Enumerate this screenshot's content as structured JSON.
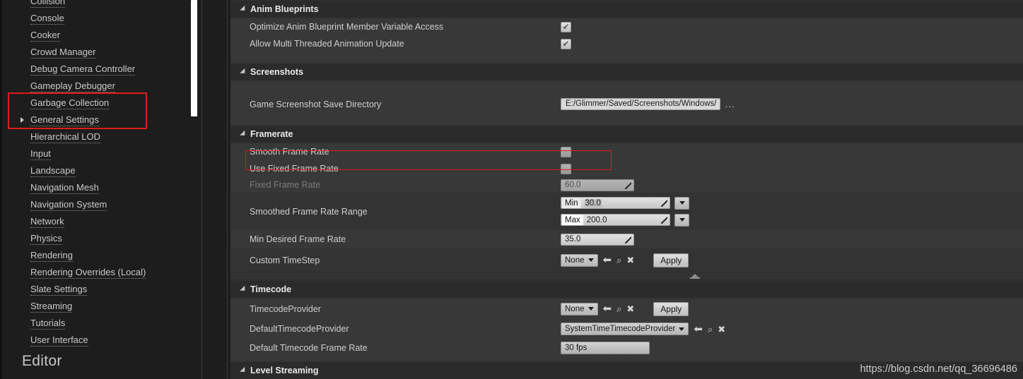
{
  "sidebar": {
    "items": [
      {
        "label": "Collision",
        "expandable": false,
        "clipped": true
      },
      {
        "label": "Console",
        "expandable": false
      },
      {
        "label": "Cooker",
        "expandable": false
      },
      {
        "label": "Crowd Manager",
        "expandable": false
      },
      {
        "label": "Debug Camera Controller",
        "expandable": false
      },
      {
        "label": "Gameplay Debugger",
        "expandable": false
      },
      {
        "label": "Garbage Collection",
        "expandable": false,
        "highlighted": true
      },
      {
        "label": "General Settings",
        "expandable": true,
        "highlighted": true
      },
      {
        "label": "Hierarchical LOD",
        "expandable": false
      },
      {
        "label": "Input",
        "expandable": false
      },
      {
        "label": "Landscape",
        "expandable": false
      },
      {
        "label": "Navigation Mesh",
        "expandable": false
      },
      {
        "label": "Navigation System",
        "expandable": false
      },
      {
        "label": "Network",
        "expandable": false
      },
      {
        "label": "Physics",
        "expandable": false
      },
      {
        "label": "Rendering",
        "expandable": false
      },
      {
        "label": "Rendering Overrides (Local)",
        "expandable": false
      },
      {
        "label": "Slate Settings",
        "expandable": false
      },
      {
        "label": "Streaming",
        "expandable": false
      },
      {
        "label": "Tutorials",
        "expandable": false
      },
      {
        "label": "User Interface",
        "expandable": false
      }
    ],
    "section_header": "Editor"
  },
  "groups": {
    "anim_blueprints": "Anim Blueprints",
    "screenshots": "Screenshots",
    "framerate": "Framerate",
    "timecode": "Timecode",
    "level_streaming": "Level Streaming"
  },
  "properties": {
    "optimize_anim": {
      "label": "Optimize Anim Blueprint Member Variable Access",
      "checked": true
    },
    "multi_threaded": {
      "label": "Allow Multi Threaded Animation Update",
      "checked": true
    },
    "screenshot_dir": {
      "label": "Game Screenshot Save Directory",
      "value": "E:/Glimmer/Saved/Screenshots/Windows/",
      "browse": "..."
    },
    "smooth_frame_rate": {
      "label": "Smooth Frame Rate",
      "checked": false
    },
    "use_fixed_frame_rate": {
      "label": "Use Fixed Frame Rate",
      "checked": false
    },
    "fixed_frame_rate": {
      "label": "Fixed Frame Rate",
      "value": "60.0",
      "enabled": false
    },
    "smoothed_range": {
      "label": "Smoothed Frame Rate Range",
      "min_prefix": "Min",
      "min_value": "30.0",
      "max_prefix": "Max",
      "max_value": "200.0"
    },
    "min_desired": {
      "label": "Min Desired Frame Rate",
      "value": "35.0"
    },
    "custom_timestep": {
      "label": "Custom TimeStep",
      "value": "None",
      "apply": "Apply"
    },
    "timecode_provider": {
      "label": "TimecodeProvider",
      "value": "None",
      "apply": "Apply"
    },
    "default_timecode_provider": {
      "label": "DefaultTimecodeProvider",
      "value": "SystemTimeTimecodeProvider"
    },
    "default_timecode_frame_rate": {
      "label": "Default Timecode Frame Rate",
      "value": "30 fps"
    }
  },
  "icons": {
    "check": "✔",
    "back_arrow": "⬅",
    "browse": "⌕",
    "clear": "✖"
  },
  "watermark": "https://blog.csdn.net/qq_36696486",
  "colors": {
    "highlight": "#e01b1b",
    "panel_bg": "#383838",
    "group_bg": "#2b2b2b",
    "sidebar_bg": "#1d1d1d"
  }
}
